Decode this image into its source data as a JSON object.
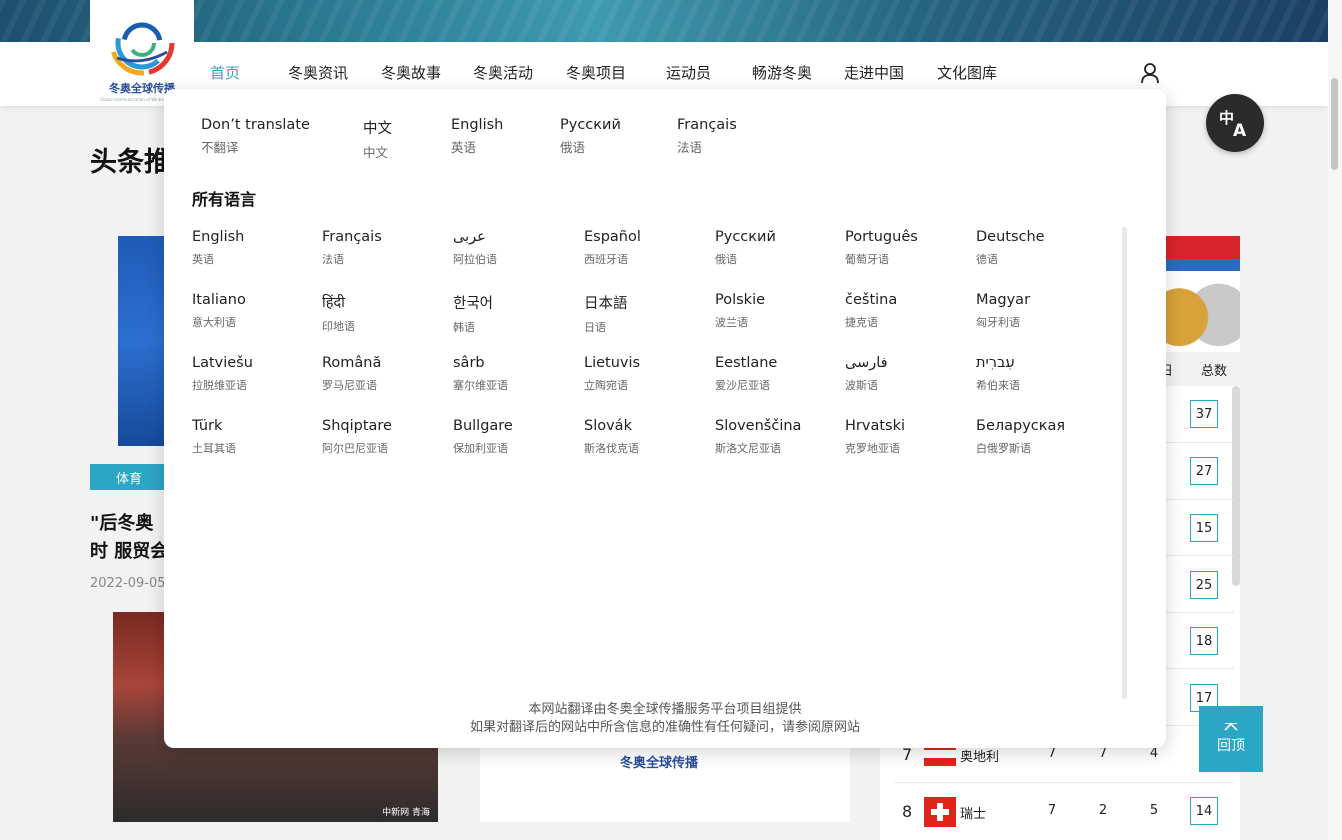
{
  "brand": {
    "logo_text": "冬奥全球传播",
    "logo_sub": "Global communication of Winter Olympics"
  },
  "nav": {
    "items": [
      "首页",
      "冬奥资讯",
      "冬奥故事",
      "冬奥活动",
      "冬奥项目",
      "运动员",
      "畅游冬奥",
      "走进中国",
      "文化图库"
    ],
    "active_index": 0
  },
  "page": {
    "section_title": "头条推",
    "tag": "体育",
    "headline": "\"后冬奥时 服贸会",
    "date": "2022-09-05",
    "photo_watermark": "中新网 青海",
    "card_logo": "冬奥全球传播"
  },
  "medal_table": {
    "col_labels": [
      "日",
      "总数"
    ],
    "totals_partial": [
      "37",
      "27",
      "15",
      "25",
      "18",
      "17"
    ],
    "rows": [
      {
        "rank": "7",
        "country": "奥地利",
        "gold": "7",
        "silver": "7",
        "bronze": "4",
        "total": ""
      },
      {
        "rank": "8",
        "country": "瑞士",
        "gold": "7",
        "silver": "2",
        "bronze": "5",
        "total": "14"
      }
    ]
  },
  "back_to_top": "回顶",
  "translator": {
    "quick": [
      {
        "name": "Don’t translate",
        "sub": "不翻译"
      },
      {
        "name": "中文",
        "sub": "中文"
      },
      {
        "name": "English",
        "sub": "英语"
      },
      {
        "name": "Русский",
        "sub": "俄语"
      },
      {
        "name": "Français",
        "sub": "法语"
      }
    ],
    "all_title": "所有语言",
    "languages": [
      {
        "name": "English",
        "sub": "英语"
      },
      {
        "name": "Français",
        "sub": "法语"
      },
      {
        "name": "عربى",
        "sub": "阿拉伯语"
      },
      {
        "name": "Español",
        "sub": "西班牙语"
      },
      {
        "name": "Русский",
        "sub": "俄语"
      },
      {
        "name": "Português",
        "sub": "葡萄牙语"
      },
      {
        "name": "Deutsche",
        "sub": "德语"
      },
      {
        "name": "Italiano",
        "sub": "意大利语"
      },
      {
        "name": "हिंदी",
        "sub": "印地语"
      },
      {
        "name": "한국어",
        "sub": "韩语"
      },
      {
        "name": "日本語",
        "sub": "日语"
      },
      {
        "name": "Polskie",
        "sub": "波兰语"
      },
      {
        "name": "čeština",
        "sub": "捷克语"
      },
      {
        "name": "Magyar",
        "sub": "匈牙利语"
      },
      {
        "name": "Latviešu",
        "sub": "拉脱维亚语"
      },
      {
        "name": "Română",
        "sub": "罗马尼亚语"
      },
      {
        "name": "sârb",
        "sub": "塞尔维亚语"
      },
      {
        "name": "Lietuvis",
        "sub": "立陶宛语"
      },
      {
        "name": "Eestlane",
        "sub": "爱沙尼亚语"
      },
      {
        "name": "فارسی",
        "sub": "波斯语"
      },
      {
        "name": "עִברִית",
        "sub": "希伯来语"
      },
      {
        "name": "Türk",
        "sub": "土耳其语"
      },
      {
        "name": "Shqiptare",
        "sub": "阿尔巴尼亚语"
      },
      {
        "name": "Bullgare",
        "sub": "保加利亚语"
      },
      {
        "name": "Slovák",
        "sub": "斯洛伐克语"
      },
      {
        "name": "Slovenščina",
        "sub": "斯洛文尼亚语"
      },
      {
        "name": "Hrvatski",
        "sub": "克罗地亚语"
      },
      {
        "name": "Беларуская",
        "sub": "白俄罗斯语"
      }
    ],
    "footer_line1": "本网站翻译由冬奥全球传播服务平台项目组提供",
    "footer_line2": "如果对翻译后的网站中所含信息的准确性有任何疑问，请参阅原网站"
  },
  "colors": {
    "accent": "#2ba6c4",
    "brand_blue": "#2a4f9a",
    "panel_bg": "#ffffff",
    "page_bg": "#f2f2f2"
  }
}
